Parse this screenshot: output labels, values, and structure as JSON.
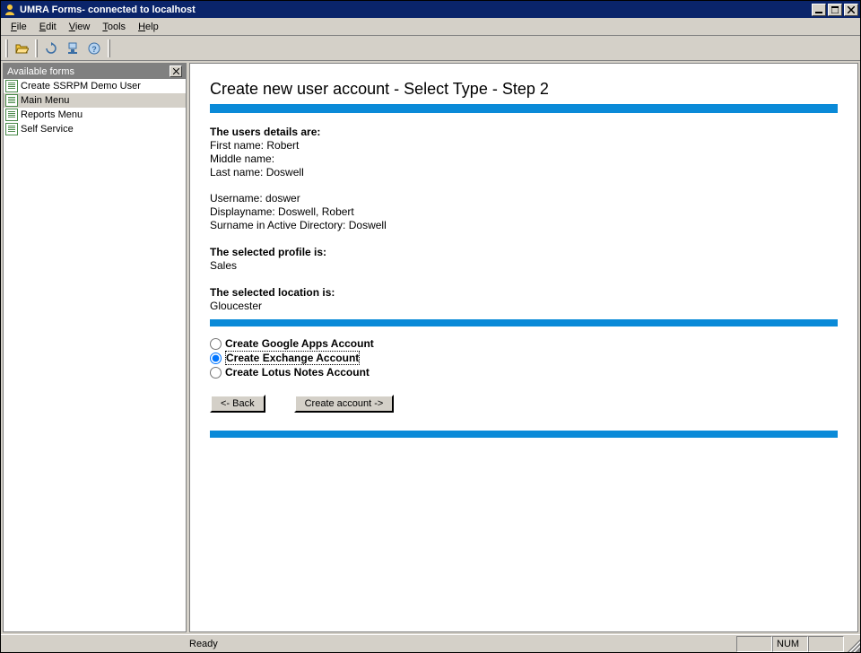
{
  "titlebar": {
    "title": "UMRA Forms- connected to localhost"
  },
  "menubar": [
    "File",
    "Edit",
    "View",
    "Tools",
    "Help"
  ],
  "sidebar": {
    "title": "Available forms",
    "items": [
      {
        "label": "Create SSRPM Demo User",
        "selected": false
      },
      {
        "label": "Main Menu",
        "selected": true
      },
      {
        "label": "Reports Menu",
        "selected": false
      },
      {
        "label": "Self Service",
        "selected": false
      }
    ]
  },
  "content": {
    "heading": "Create new user account - Select Type - Step 2",
    "details_title": "The users details are:",
    "fields": {
      "first_name_label": "First name:",
      "first_name": "Robert",
      "middle_name_label": "Middle name:",
      "middle_name": "",
      "last_name_label": "Last name:",
      "last_name": "Doswell",
      "username_label": "Username:",
      "username": "doswer",
      "displayname_label": "Displayname:",
      "displayname": "Doswell, Robert",
      "surname_ad_label": "Surname in Active Directory:",
      "surname_ad": "Doswell"
    },
    "profile_title": "The selected profile is:",
    "profile": "Sales",
    "location_title": "The selected location is:",
    "location": "Gloucester",
    "options": [
      {
        "label": "Create Google Apps Account",
        "selected": false
      },
      {
        "label": "Create Exchange Account",
        "selected": true
      },
      {
        "label": "Create Lotus Notes Account",
        "selected": false
      }
    ],
    "back_button": "<- Back",
    "create_button": "Create account ->"
  },
  "statusbar": {
    "ready": "Ready",
    "num": "NUM"
  }
}
